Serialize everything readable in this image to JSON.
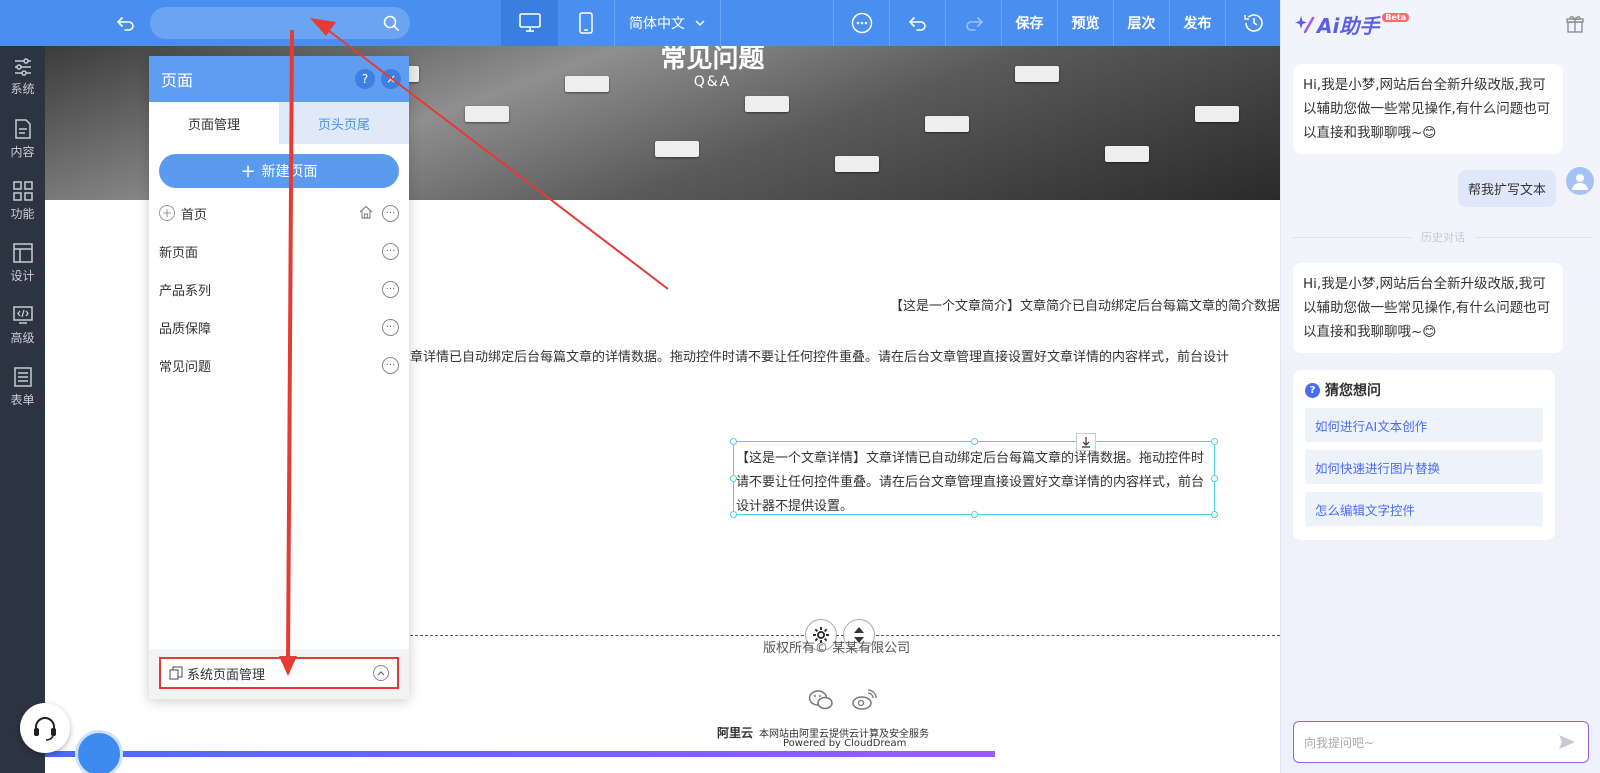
{
  "topbar": {
    "search_placeholder": "",
    "language": "简体中文",
    "save": "保存",
    "preview": "预览",
    "layers": "层次",
    "publish": "发布",
    "accent": "#4a8ff0"
  },
  "rail": {
    "items": [
      {
        "label": "系统",
        "icon": "sliders-icon"
      },
      {
        "label": "内容",
        "icon": "document-icon"
      },
      {
        "label": "功能",
        "icon": "grid-icon"
      },
      {
        "label": "设计",
        "icon": "layout-icon"
      },
      {
        "label": "高级",
        "icon": "code-icon"
      },
      {
        "label": "表单",
        "icon": "form-icon"
      }
    ]
  },
  "canvas": {
    "banner_title": "常见问题",
    "banner_subtitle": "Q&A",
    "summary_text": "【这是一个文章简介】文章简介已自动绑定后台每篇文章的简介数据",
    "detail_line": "章详情已自动绑定后台每篇文章的详情数据。拖动控件时请不要让任何控件重叠。请在后台文章管理直接设置好文章详情的内容样式，前台设计",
    "selected_text": "【这是一个文章详情】文章详情已自动绑定后台每篇文章的详情数据。拖动控件时请不要让任何控件重叠。请在后台文章管理直接设置好文章详情的内容样式，前台设计器不提供设置。",
    "copyright": "版权所有© 某某有限公司",
    "aliyun_logo": "阿里云",
    "aliyun_text": "本网站由阿里云提供云计算及安全服务",
    "powered_by": "Powered by CloudDream"
  },
  "page_panel": {
    "title": "页面",
    "help": "?",
    "close": "×",
    "tabs": [
      "页面管理",
      "页头页尾"
    ],
    "new_page": "新建页面",
    "pages": [
      "首页",
      "新页面",
      "产品系列",
      "品质保障",
      "常见问题"
    ],
    "system_pages": "系统页面管理",
    "highlight_color": "#e53b35"
  },
  "ai": {
    "logo": "Ai助手",
    "beta": "Beta",
    "greeting": "Hi,我是小梦,网站后台全新升级改版,我可以辅助您做一些常见操作,有什么问题也可以直接和我聊聊哦~😊",
    "user_message": "帮我扩写文本",
    "history_label": "历史对话",
    "guess_title": "猜您想问",
    "guesses": [
      "如何进行AI文本创作",
      "如何快速进行图片替换",
      "怎么编辑文字控件"
    ],
    "input_placeholder": "向我提问吧~",
    "accent": "#5a5fe8"
  }
}
